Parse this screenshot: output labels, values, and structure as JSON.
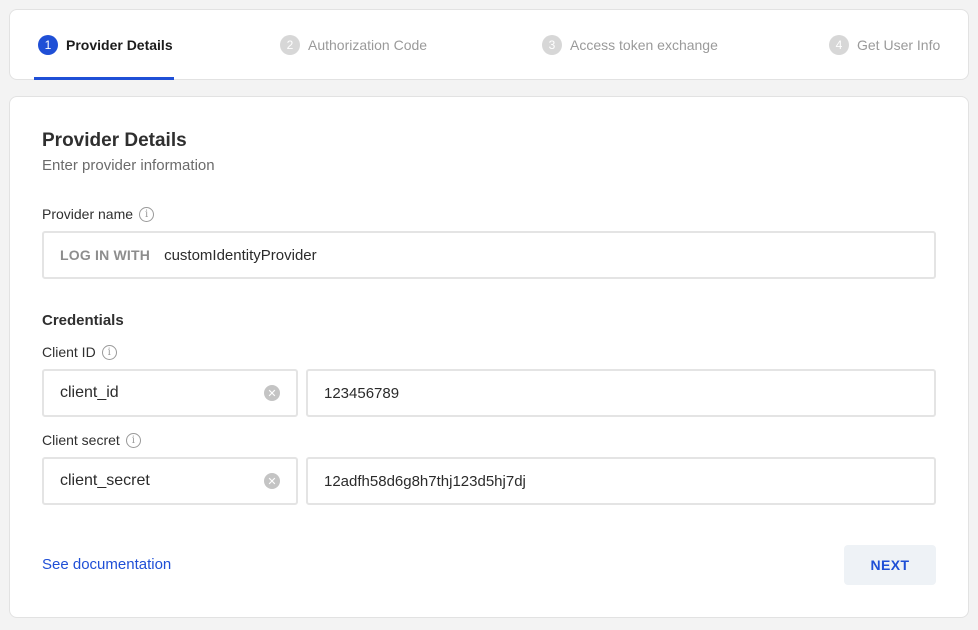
{
  "steps": [
    {
      "number": "1",
      "label": "Provider Details"
    },
    {
      "number": "2",
      "label": "Authorization Code"
    },
    {
      "number": "3",
      "label": "Access token exchange"
    },
    {
      "number": "4",
      "label": "Get User Info"
    }
  ],
  "form": {
    "title": "Provider Details",
    "subtitle": "Enter provider information",
    "provider_name": {
      "label": "Provider name",
      "prefix": "LOG IN WITH",
      "value": "customIdentityProvider"
    },
    "credentials_heading": "Credentials",
    "client_id": {
      "label": "Client ID",
      "key": "client_id",
      "value": "123456789"
    },
    "client_secret": {
      "label": "Client secret",
      "key": "client_secret",
      "value": "12adfh58d6g8h7thj123d5hj7dj"
    },
    "doc_link": "See documentation",
    "next_label": "NEXT"
  },
  "icons": {
    "info": "info-icon",
    "clear": "clear-circle-icon"
  },
  "colors": {
    "accent": "#1f4fd6",
    "inactive_step": "#d7d7d7",
    "button_bg": "#eef2f6"
  }
}
